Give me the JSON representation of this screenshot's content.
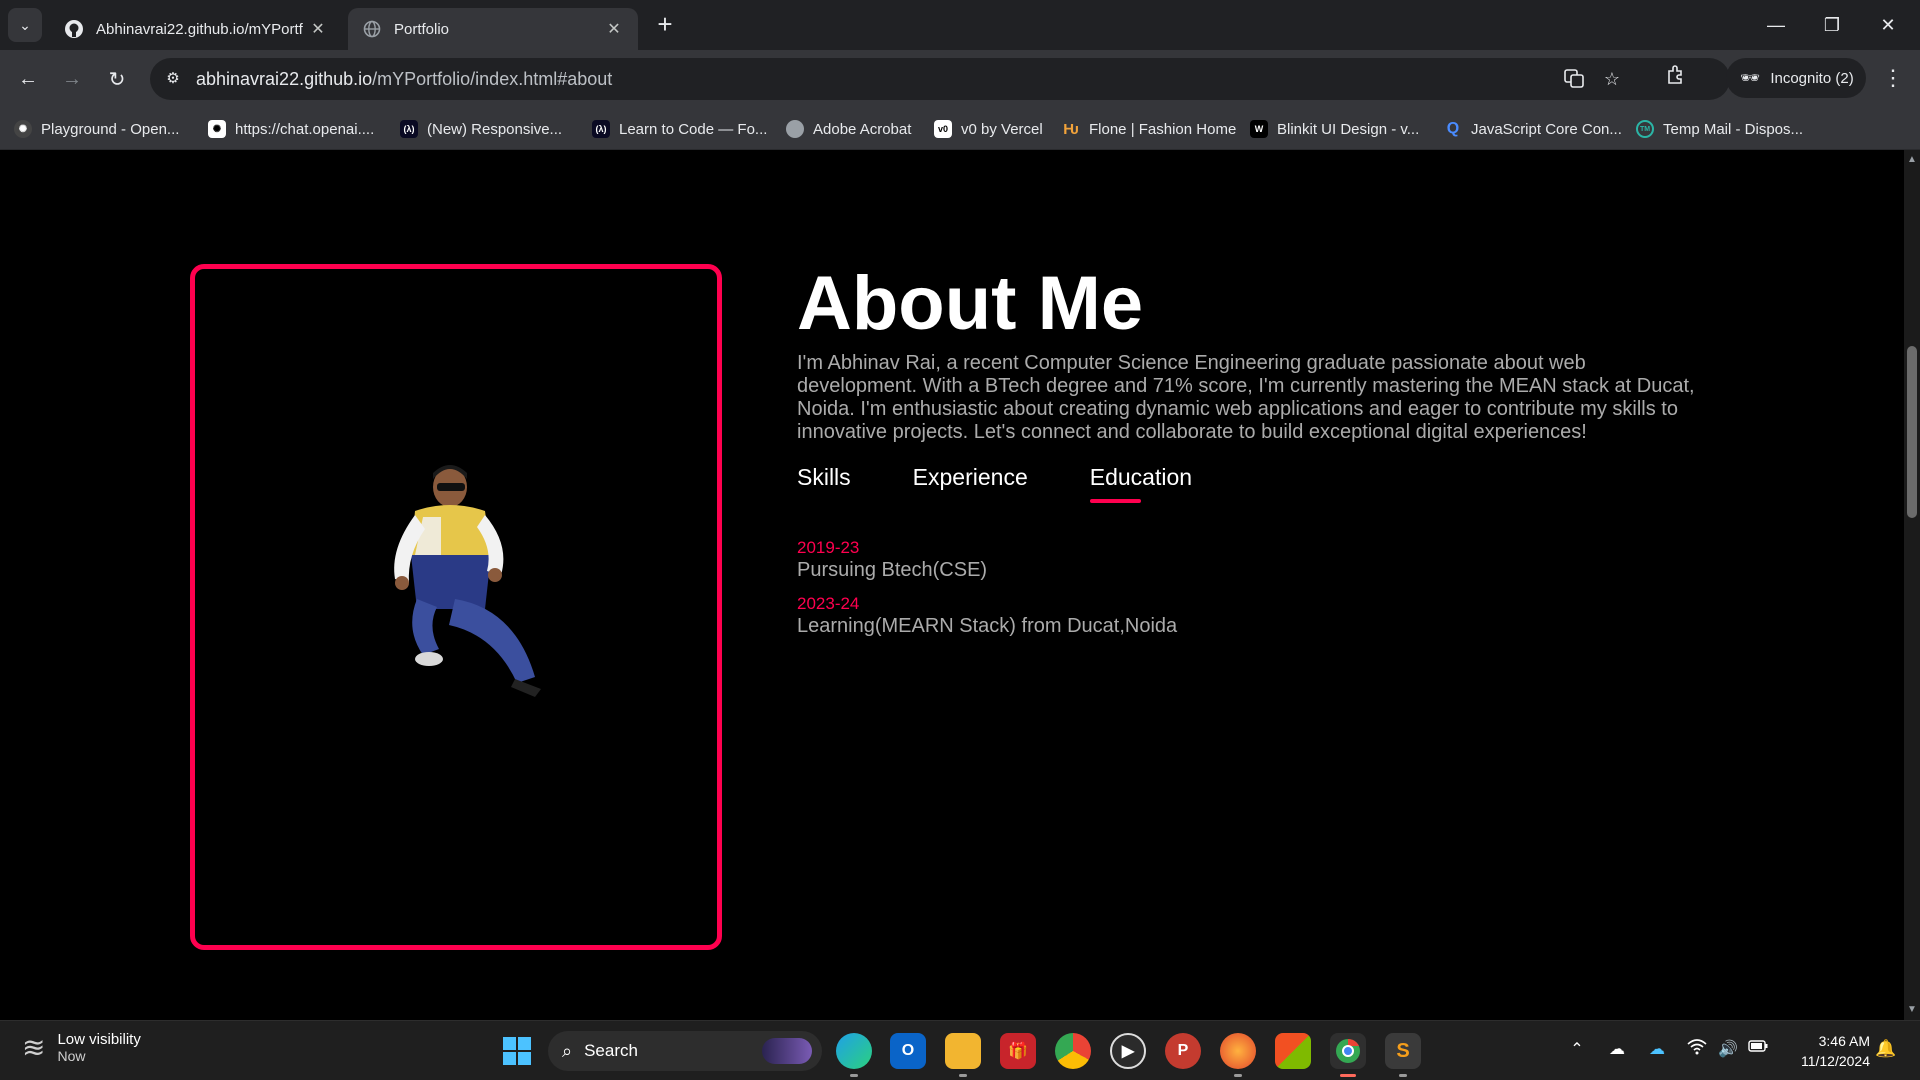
{
  "browser": {
    "tabs": [
      {
        "title": "Abhinavrai22.github.io/mYPortf",
        "active": false
      },
      {
        "title": "Portfolio",
        "active": true
      }
    ],
    "url_host": "abhinavrai22.github.io",
    "url_path": "/mYPortfolio/index.html#about",
    "profile_label": "Incognito (2)",
    "bookmarks": [
      {
        "label": "Playground - Open...",
        "icon": "openai-icon"
      },
      {
        "label": "https://chat.openai....",
        "icon": "openai-icon"
      },
      {
        "label": "(New) Responsive...",
        "icon": "freecodecamp-icon"
      },
      {
        "label": "Learn to Code — Fo...",
        "icon": "freecodecamp-icon"
      },
      {
        "label": "Adobe Acrobat",
        "icon": "globe-icon"
      },
      {
        "label": "v0 by Vercel",
        "icon": "v0-icon"
      },
      {
        "label": "Flone | Fashion Home",
        "icon": "flone-icon"
      },
      {
        "label": "Blinkit UI Design - v...",
        "icon": "figma-icon"
      },
      {
        "label": "JavaScript Core Con...",
        "icon": "search-magnifier-icon"
      },
      {
        "label": "Temp Mail - Dispos...",
        "icon": "tempmail-icon"
      }
    ]
  },
  "page": {
    "about_title": "About Me",
    "about_text": "I'm Abhinav Rai, a recent Computer Science Engineering graduate passionate about web development. With a BTech degree and 71% score, I'm currently mastering the MEAN stack at Ducat, Noida. I'm enthusiastic about creating dynamic web applications and eager to contribute my skills to innovative projects. Let's connect and collaborate to build exceptional digital experiences!",
    "tabs": [
      {
        "label": "Skills",
        "active": false
      },
      {
        "label": "Experience",
        "active": false
      },
      {
        "label": "Education",
        "active": true
      }
    ],
    "education": [
      {
        "year": "2019-23",
        "desc": "Pursuing Btech(CSE)"
      },
      {
        "year": "2023-24",
        "desc": "Learning(MEARN Stack) from Ducat,Noida"
      }
    ],
    "accent_color": "#ff004f"
  },
  "taskbar": {
    "weather_title": "Low visibility",
    "weather_sub": "Now",
    "search_label": "Search",
    "time": "3:46 AM",
    "date": "11/12/2024"
  }
}
